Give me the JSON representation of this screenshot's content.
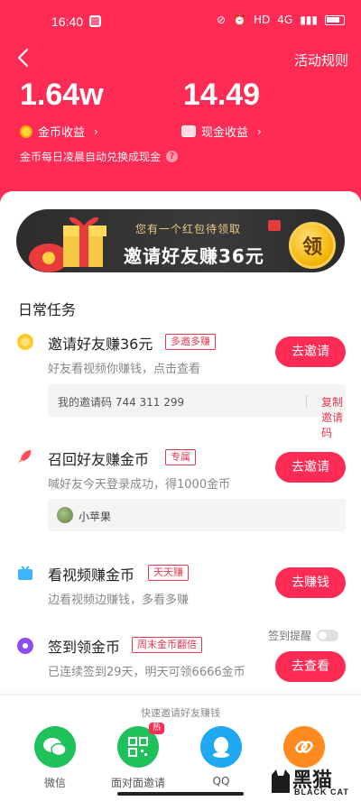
{
  "status_bar": {
    "time": "16:40",
    "network": "HD",
    "signal": "4G"
  },
  "header": {
    "rules_link": "活动规则",
    "coin_amount": "1.64w",
    "coin_label": "金币收益",
    "cash_amount": "14.49",
    "cash_label": "现金收益",
    "note": "金币每日凌晨自动兑换成现金"
  },
  "banner": {
    "subtitle": "您有一个红包待领取",
    "title": "邀请好友赚36元",
    "claim_button": "领"
  },
  "section_title": "日常任务",
  "tasks": [
    {
      "title": "邀请好友赚36元",
      "tag": "多邀多赚",
      "desc": "好友看视频你赚钱，点击查看",
      "button": "去邀请",
      "invite_code_text": "我的邀请码 744 311 299",
      "copy_link": "复制邀请码"
    },
    {
      "title": "召回好友赚金币",
      "tag": "专属",
      "desc": "喊好友今天登录成功，得1000金币",
      "button": "去邀请",
      "friend_name": "小苹果"
    },
    {
      "title": "看视频赚金币",
      "tag": "天天赚",
      "desc": "边看视频边赚钱，多看多赚",
      "button": "去赚钱"
    },
    {
      "title": "签到领金币",
      "tag": "周末金币翻倍",
      "desc": "已连续签到29天，明天可领6666金币",
      "button": "去查看",
      "reminder_label": "签到提醒",
      "reminder_on": false
    }
  ],
  "share_panel": {
    "title": "快速邀请好友赚钱",
    "items": [
      {
        "label": "微信",
        "color": "#1fc25a",
        "icon": "wechat-icon"
      },
      {
        "label": "面对面邀请",
        "color": "#1fc25a",
        "icon": "qrcode-icon",
        "badge": "热"
      },
      {
        "label": "QQ",
        "color": "#20a8f0",
        "icon": "qq-icon"
      },
      {
        "label": "",
        "color": "#ff8a1f",
        "icon": "link-icon"
      }
    ]
  },
  "watermark": {
    "cn": "黑猫",
    "en": "BLACK CAT"
  },
  "colors": {
    "brand": "#fe2c55",
    "banner_gold": "#e8c98a"
  }
}
